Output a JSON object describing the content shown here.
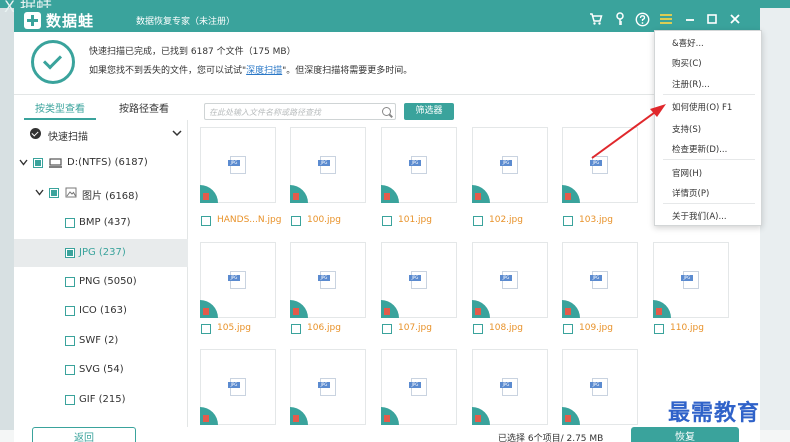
{
  "background": {
    "text": "X 据蛙"
  },
  "titlebar": {
    "app_name": "数据蛙",
    "subtitle": "数据恢复专家（未注册）",
    "icons": [
      "cart-icon",
      "key-icon",
      "help-icon",
      "menu-icon",
      "minimize-icon",
      "maximize-icon",
      "close-icon"
    ]
  },
  "header": {
    "status_line": "快速扫描已完成，已找到 6187 个文件（175 MB）",
    "hint_prefix": "如果您找不到丢失的文件，您可以试试\"",
    "deep_scan_link": "深度扫描",
    "hint_suffix": "\"。但深度扫描将需要更多时间。"
  },
  "tabs": [
    {
      "label": "按类型查看",
      "active": true
    },
    {
      "label": "按路径查看",
      "active": false
    }
  ],
  "sidebar": {
    "quick_scan": "快速扫描",
    "drive": "D:(NTFS) (6187)",
    "pictures": "图片 (6168)",
    "types": [
      {
        "label": "BMP (437)",
        "selected": false
      },
      {
        "label": "JPG (237)",
        "selected": true
      },
      {
        "label": "PNG (5050)",
        "selected": false
      },
      {
        "label": "ICO (163)",
        "selected": false
      },
      {
        "label": "SWF (2)",
        "selected": false
      },
      {
        "label": "SVG (54)",
        "selected": false
      },
      {
        "label": "GIF (215)",
        "selected": false
      }
    ]
  },
  "toolbar": {
    "search_placeholder": "在此处输入文件名称或路径查找",
    "filter_label": "筛选器"
  },
  "files": {
    "row1": [
      "HANDS...N.jpg",
      "100.jpg",
      "101.jpg",
      "102.jpg",
      "103.jpg"
    ],
    "row2": [
      "105.jpg",
      "106.jpg",
      "107.jpg",
      "108.jpg",
      "109.jpg",
      "110.jpg"
    ]
  },
  "footer": {
    "back_label": "返回",
    "selection_status": "已选择 6个项目/ 2.75 MB",
    "recover_label": "恢复"
  },
  "menu": {
    "items": [
      "&喜好...",
      "购买(C)",
      "注册(R)...",
      "如何使用(O)   F1",
      "支持(S)",
      "检查更新(D)...",
      "官网(H)",
      "详情页(P)",
      "关于我们(A)..."
    ]
  },
  "watermark": "最需教育",
  "colors": {
    "accent": "#3aa39c",
    "file_name": "#e8922a",
    "link": "#2a78c7",
    "arrow": "#e0282c"
  }
}
